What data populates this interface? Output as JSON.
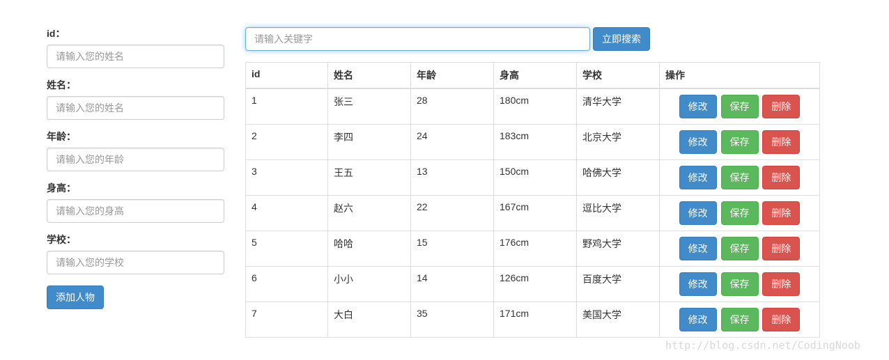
{
  "form": {
    "fields": [
      {
        "label": "id：",
        "placeholder": "请输入您的姓名"
      },
      {
        "label": "姓名：",
        "placeholder": "请输入您的姓名"
      },
      {
        "label": "年龄：",
        "placeholder": "请输入您的年龄"
      },
      {
        "label": "身高：",
        "placeholder": "请输入您的身高"
      },
      {
        "label": "学校：",
        "placeholder": "请输入您的学校"
      }
    ],
    "add_button": "添加人物"
  },
  "search": {
    "placeholder": "请输入关键字",
    "button": "立即搜索"
  },
  "table": {
    "headers": [
      "id",
      "姓名",
      "年龄",
      "身高",
      "学校",
      "操作"
    ],
    "rows": [
      {
        "id": "1",
        "name": "张三",
        "age": "28",
        "height": "180cm",
        "school": "清华大学"
      },
      {
        "id": "2",
        "name": "李四",
        "age": "24",
        "height": "183cm",
        "school": "北京大学"
      },
      {
        "id": "3",
        "name": "王五",
        "age": "13",
        "height": "150cm",
        "school": "哈佛大学"
      },
      {
        "id": "4",
        "name": "赵六",
        "age": "22",
        "height": "167cm",
        "school": "逗比大学"
      },
      {
        "id": "5",
        "name": "哈哈",
        "age": "15",
        "height": "176cm",
        "school": "野鸡大学"
      },
      {
        "id": "6",
        "name": "小小",
        "age": "14",
        "height": "126cm",
        "school": "百度大学"
      },
      {
        "id": "7",
        "name": "大白",
        "age": "35",
        "height": "171cm",
        "school": "美国大学"
      }
    ],
    "actions": {
      "edit": "修改",
      "save": "保存",
      "delete": "删除"
    }
  },
  "watermark": "http://blog.csdn.net/CodingNoob",
  "colors": {
    "primary": "#428bca",
    "success": "#5cb85c",
    "danger": "#d9534f"
  }
}
